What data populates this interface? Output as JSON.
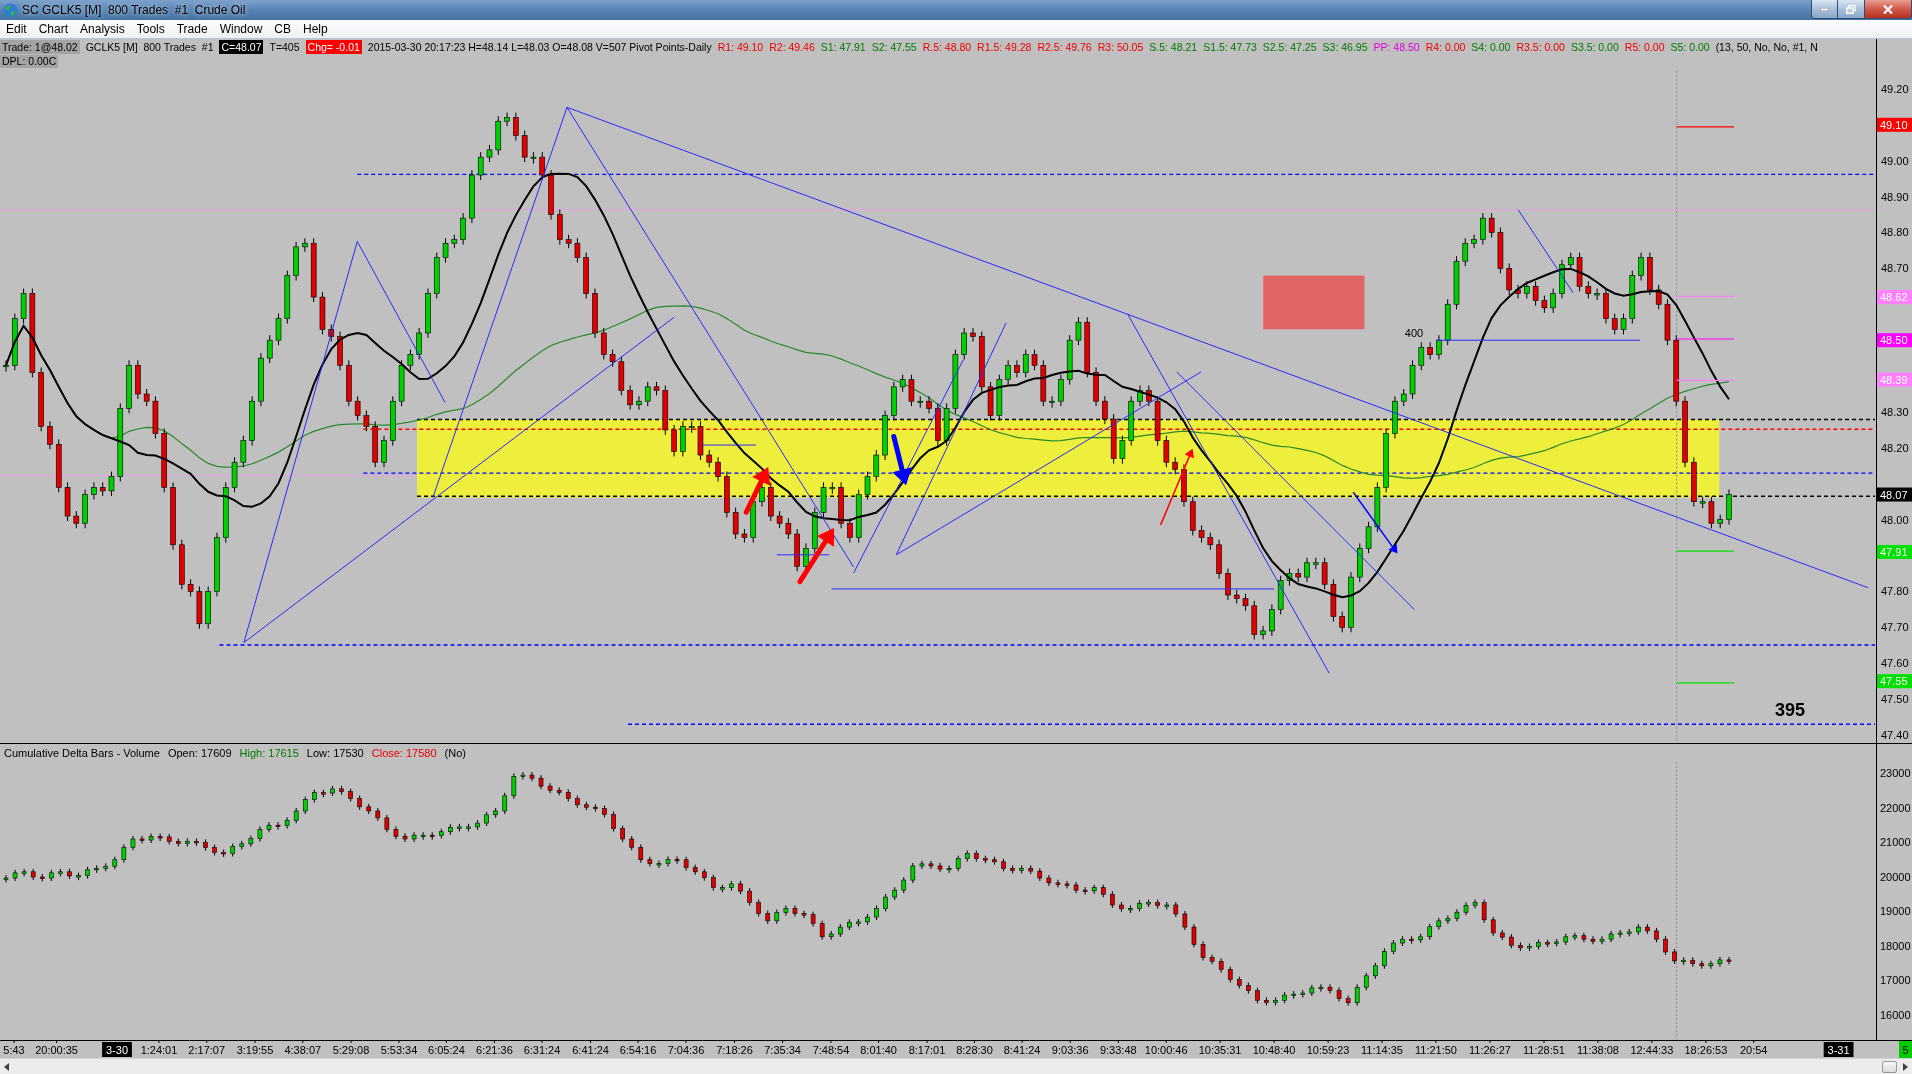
{
  "window": {
    "title": "SC GCLK5 [M]  800 Trades  #1  Crude Oil"
  },
  "menu": [
    "Edit",
    "Chart",
    "Analysis",
    "Tools",
    "Trade",
    "Window",
    "CB",
    "Help"
  ],
  "info_line": [
    {
      "text": "Trade: 1@48.02",
      "kind": "gray"
    },
    {
      "text": "GCLK5 [M]  800 Trades  #1",
      "kind": "plain"
    },
    {
      "text": "C=48.07",
      "kind": "inverse"
    },
    {
      "text": "T=405",
      "kind": "plain"
    },
    {
      "text": "Chg= -0.01",
      "kind": "alert"
    },
    {
      "text": "2015-03-30 20:17:23 H=48.14 L=48.03 O=48.08 V=507 Pivot Points-Daily",
      "kind": "plain"
    },
    {
      "text": "R1: 49.10",
      "kind": "resistance"
    },
    {
      "text": "R2: 49.46",
      "kind": "resistance"
    },
    {
      "text": "S1: 47.91",
      "kind": "support"
    },
    {
      "text": "S2: 47.55",
      "kind": "support"
    },
    {
      "text": "R.5: 48.80",
      "kind": "resistance"
    },
    {
      "text": "R1.5: 49.28",
      "kind": "resistance"
    },
    {
      "text": "R2.5: 49.76",
      "kind": "resistance"
    },
    {
      "text": "R3: 50.05",
      "kind": "resistance"
    },
    {
      "text": "S.5: 48.21",
      "kind": "support"
    },
    {
      "text": "S1.5: 47.73",
      "kind": "support"
    },
    {
      "text": "S2.5: 47.25",
      "kind": "support"
    },
    {
      "text": "S3: 46.95",
      "kind": "support"
    },
    {
      "text": "PP: 48.50",
      "kind": "pivot"
    },
    {
      "text": "R4: 0.00",
      "kind": "resistance"
    },
    {
      "text": "S4: 0.00",
      "kind": "support"
    },
    {
      "text": "R3.5: 0.00",
      "kind": "resistance"
    },
    {
      "text": "S3.5: 0.00",
      "kind": "support"
    },
    {
      "text": "R5: 0.00",
      "kind": "resistance"
    },
    {
      "text": "S5: 0.00",
      "kind": "support"
    },
    {
      "text": "(13, 50, No, No, #1, N",
      "kind": "plain"
    }
  ],
  "dpl": "DPL: 0.00C",
  "price_chart": {
    "axis_labels": [
      "49.20",
      "49.00",
      "48.90",
      "48.80",
      "48.70",
      "48.30",
      "48.20",
      "48.00",
      "47.80",
      "47.70",
      "47.60",
      "47.50",
      "47.40"
    ],
    "price_tags": [
      {
        "label": "49.10",
        "color": "#ff0000"
      },
      {
        "label": "48.62",
        "color": "#ff80ff"
      },
      {
        "label": "48.50",
        "color": "#ff00ff"
      },
      {
        "label": "48.39",
        "color": "#ff80ff"
      },
      {
        "label": "48.07",
        "color": "#000000"
      },
      {
        "label": "47.91",
        "color": "#00e000"
      },
      {
        "label": "47.55",
        "color": "#00e000"
      }
    ],
    "notes": [
      {
        "text": "400",
        "kind": "small"
      },
      {
        "text": "395",
        "kind": "large"
      }
    ]
  },
  "delta_panel": {
    "header": [
      {
        "text": "Cumulative Delta Bars - Volume",
        "kind": "title"
      },
      {
        "text": "Open: 17609",
        "kind": "plain"
      },
      {
        "text": "High: 17615",
        "kind": "up"
      },
      {
        "text": "Low: 17530",
        "kind": "plain"
      },
      {
        "text": "Close: 17580",
        "kind": "down"
      },
      {
        "text": "(No)",
        "kind": "plain"
      }
    ],
    "axis_labels": [
      "23000",
      "22000",
      "21000",
      "20000",
      "19000",
      "18000",
      "17000",
      "16000"
    ],
    "corner_badge": "5"
  },
  "time_axis": [
    {
      "label": "5:43",
      "kind": "time"
    },
    {
      "label": "20:00:35",
      "kind": "time"
    },
    {
      "label": "3-30",
      "kind": "date"
    },
    {
      "label": "1:24:01",
      "kind": "time"
    },
    {
      "label": "2:17:07",
      "kind": "time"
    },
    {
      "label": "3:19:55",
      "kind": "time"
    },
    {
      "label": "4:38:07",
      "kind": "time"
    },
    {
      "label": "5:29:08",
      "kind": "time"
    },
    {
      "label": "5:53:34",
      "kind": "time"
    },
    {
      "label": "6:05:24",
      "kind": "time"
    },
    {
      "label": "6:21:36",
      "kind": "time"
    },
    {
      "label": "6:31:24",
      "kind": "time"
    },
    {
      "label": "6:41:24",
      "kind": "time"
    },
    {
      "label": "6:54:16",
      "kind": "time"
    },
    {
      "label": "7:04:36",
      "kind": "time"
    },
    {
      "label": "7:18:26",
      "kind": "time"
    },
    {
      "label": "7:35:34",
      "kind": "time"
    },
    {
      "label": "7:48:54",
      "kind": "time"
    },
    {
      "label": "8:01:40",
      "kind": "time"
    },
    {
      "label": "8:17:01",
      "kind": "time"
    },
    {
      "label": "8:28:30",
      "kind": "time"
    },
    {
      "label": "8:41:24",
      "kind": "time"
    },
    {
      "label": "9:03:36",
      "kind": "time"
    },
    {
      "label": "9:33:48",
      "kind": "time"
    },
    {
      "label": "10:00:46",
      "kind": "time"
    },
    {
      "label": "10:35:31",
      "kind": "time"
    },
    {
      "label": "10:48:40",
      "kind": "time"
    },
    {
      "label": "10:59:23",
      "kind": "time"
    },
    {
      "label": "11:14:35",
      "kind": "time"
    },
    {
      "label": "11:21:50",
      "kind": "time"
    },
    {
      "label": "11:26:27",
      "kind": "time"
    },
    {
      "label": "11:28:51",
      "kind": "time"
    },
    {
      "label": "11:38:08",
      "kind": "time"
    },
    {
      "label": "12:44:33",
      "kind": "time"
    },
    {
      "label": "18:26:53",
      "kind": "time"
    },
    {
      "label": "20:54",
      "kind": "time"
    },
    {
      "label": "3-31",
      "kind": "date"
    }
  ]
}
